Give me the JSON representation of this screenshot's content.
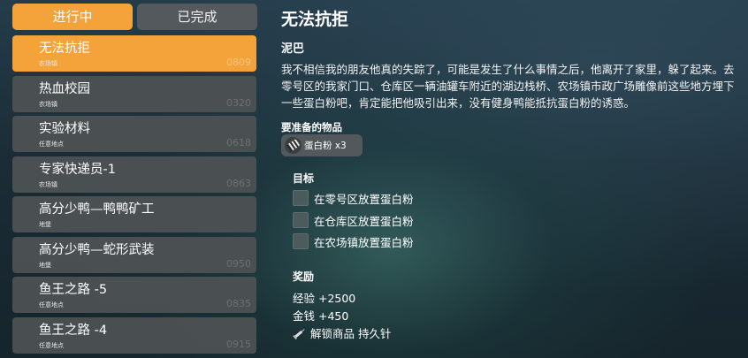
{
  "tabs": {
    "active": "进行中",
    "done": "已完成"
  },
  "quests": [
    {
      "title": "无法抗拒",
      "location": "农场镇",
      "code": "0809",
      "selected": true
    },
    {
      "title": "热血校园",
      "location": "农场镇",
      "code": "0320",
      "selected": false
    },
    {
      "title": "实验材料",
      "location": "任意地点",
      "code": "0618",
      "selected": false
    },
    {
      "title": "专家快递员-1",
      "location": "农场镇",
      "code": "0863",
      "selected": false
    },
    {
      "title": "高分少鸭—鸭鸭矿工",
      "location": "地堡",
      "code": "",
      "selected": false
    },
    {
      "title": "高分少鸭—蛇形武装",
      "location": "地堡",
      "code": "0950",
      "selected": false
    },
    {
      "title": "鱼王之路 -5",
      "location": "任意地点",
      "code": "0835",
      "selected": false
    },
    {
      "title": "鱼王之路 -4",
      "location": "任意地点",
      "code": "0915",
      "selected": false
    }
  ],
  "detail": {
    "title": "无法抗拒",
    "giver": "泥巴",
    "description": "我不相信我的朋友他真的失踪了，可能是发生了什么事情之后，他离开了家里，躲了起来。去零号区的我家门口、仓库区一辆油罐车附近的湖边栈桥、农场镇市政广场雕像前这些地方埋下一些蛋白粉吧，肯定能把他吸引出来，没有健身鸭能抵抗蛋白粉的诱惑。",
    "required_label": "要准备的物品",
    "required_item": "蛋白粉 x3",
    "objectives_label": "目标",
    "objectives": [
      "在零号区放置蛋白粉",
      "在仓库区放置蛋白粉",
      "在农场镇放置蛋白粉"
    ],
    "rewards_label": "奖励",
    "rewards": {
      "exp": "经验 +2500",
      "money": "金钱 +450",
      "unlock": "解锁商品 持久针"
    }
  },
  "colors": {
    "accent": "#f3a33a",
    "panel": "#4e5254",
    "inactive_tab": "#54595d"
  }
}
